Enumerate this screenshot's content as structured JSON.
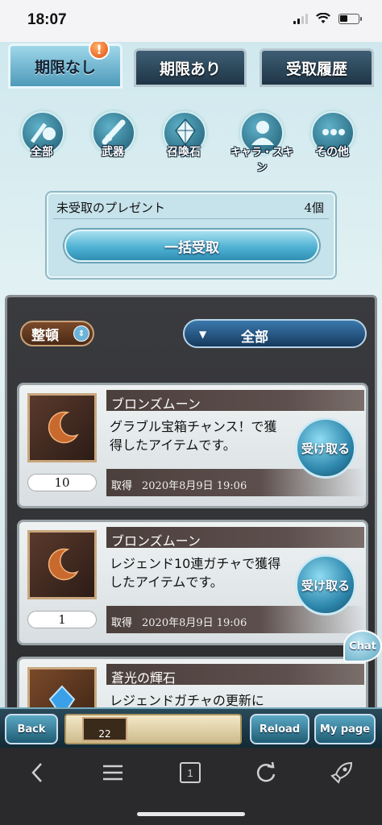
{
  "status_bar": {
    "time": "18:07"
  },
  "tabs": [
    {
      "label": "期限なし",
      "active": true,
      "badge": "!"
    },
    {
      "label": "期限あり",
      "active": false
    },
    {
      "label": "受取履歴",
      "active": false
    }
  ],
  "categories": [
    {
      "label": "全部",
      "icon": "all-icon"
    },
    {
      "label": "武器",
      "icon": "sword-icon"
    },
    {
      "label": "召喚石",
      "icon": "crystal-icon"
    },
    {
      "label": "キャラ・スキン",
      "icon": "character-icon"
    },
    {
      "label": "その他",
      "icon": "more-icon"
    }
  ],
  "unclaimed": {
    "title": "未受取のプレゼント",
    "count": "4個",
    "bulk_label": "一括受取"
  },
  "controls": {
    "sort_label": "整頓",
    "filter_value": "全部"
  },
  "items": [
    {
      "name": "ブロンズムーン",
      "desc": "グラブル宝箱チャンス！で獲得したアイテムです。",
      "qty": "10",
      "acquired_label": "取得",
      "date": "2020年8月9日 19:06",
      "claim_label": "受け取る",
      "icon": "crescent-moon-icon"
    },
    {
      "name": "ブロンズムーン",
      "desc": "レジェンド10連ガチャで獲得したアイテムです。",
      "qty": "1",
      "acquired_label": "取得",
      "date": "2020年8月9日 19:06",
      "claim_label": "受け取る",
      "icon": "crescent-moon-icon"
    },
    {
      "name": "蒼光の輝石",
      "desc": "レジェンドガチャの更新に",
      "icon": "blue-gem-icon"
    }
  ],
  "chat_label": "Chat",
  "bottom_bar": {
    "back": "Back",
    "level": "22",
    "reload": "Reload",
    "mypage": "My page"
  },
  "browser_tab_count": "1"
}
